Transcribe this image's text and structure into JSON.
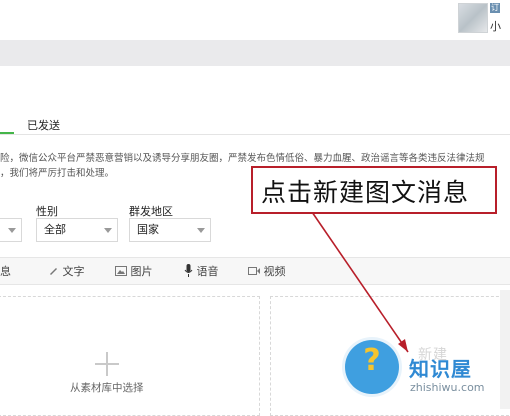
{
  "header": {
    "user_name": "小",
    "avatar_corner_glyph": "订"
  },
  "tabs": {
    "sent_label": "已发送"
  },
  "notice": {
    "line1": "险，微信公众平台严禁恶意营销以及诱导分享朋友圈，严禁发布色情低俗、暴力血腥、政治谣言等各类违反法律法规",
    "line2": "，我们将严厉打击和处理。"
  },
  "filters": {
    "gender_label": "性别",
    "gender_value": "全部",
    "region_label": "群发地区",
    "region_value": "国家"
  },
  "message_types": {
    "news_label": "息",
    "text_label": "文字",
    "image_label": "图片",
    "voice_label": "语音",
    "video_label": "视频"
  },
  "editor": {
    "choose_from_library": "从素材库中选择",
    "right_faint_text": "新建"
  },
  "annotation": {
    "callout_text": "点击新建图文消息",
    "callout_color": "#b81f2a"
  },
  "watermark": {
    "title": "知识屋",
    "subtitle": "zhishiwu.com",
    "icon": "question-mark-bulb-icon"
  },
  "colors": {
    "accent_green": "#44b549",
    "header_band": "#eaeaec"
  }
}
